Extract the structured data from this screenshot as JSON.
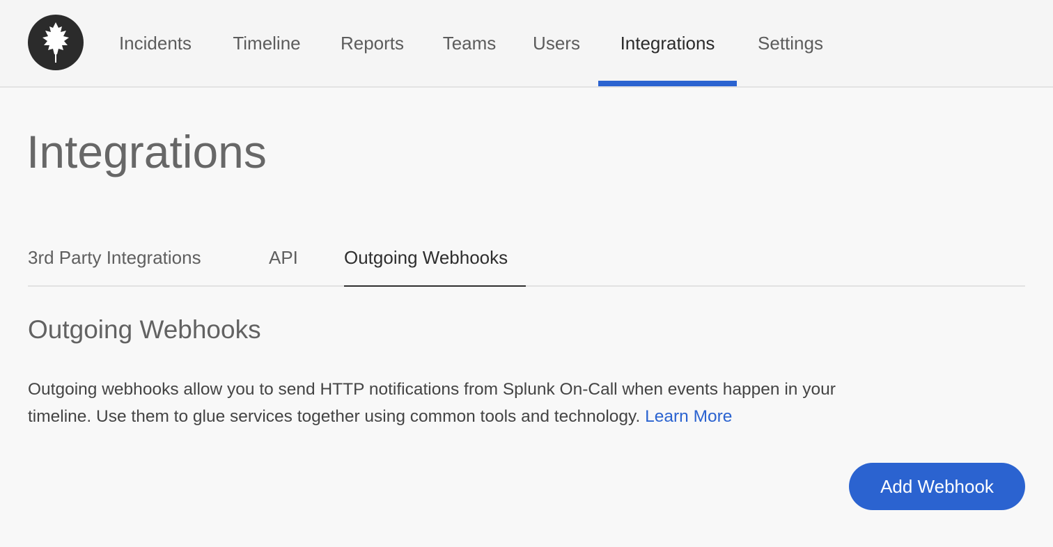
{
  "nav": {
    "logo": "leaf-logo",
    "items": [
      {
        "label": "Incidents",
        "active": false
      },
      {
        "label": "Timeline",
        "active": false
      },
      {
        "label": "Reports",
        "active": false
      },
      {
        "label": "Teams",
        "active": false
      },
      {
        "label": "Users",
        "active": false
      },
      {
        "label": "Integrations",
        "active": true
      },
      {
        "label": "Settings",
        "active": false
      }
    ]
  },
  "page": {
    "title": "Integrations"
  },
  "tabs": [
    {
      "label": "3rd Party Integrations",
      "active": false
    },
    {
      "label": "API",
      "active": false
    },
    {
      "label": "Outgoing Webhooks",
      "active": true
    }
  ],
  "section": {
    "title": "Outgoing Webhooks",
    "description_line1": "Outgoing webhooks allow you to send HTTP notifications from Splunk On-Call when events happen in your",
    "description_line2": "timeline. Use them to glue services together using common tools and technology.",
    "learn_more": "Learn More",
    "add_button": "Add Webhook"
  },
  "colors": {
    "accent": "#2b63d0",
    "background": "#f8f8f8",
    "logo_bg": "#2b2b2b"
  }
}
